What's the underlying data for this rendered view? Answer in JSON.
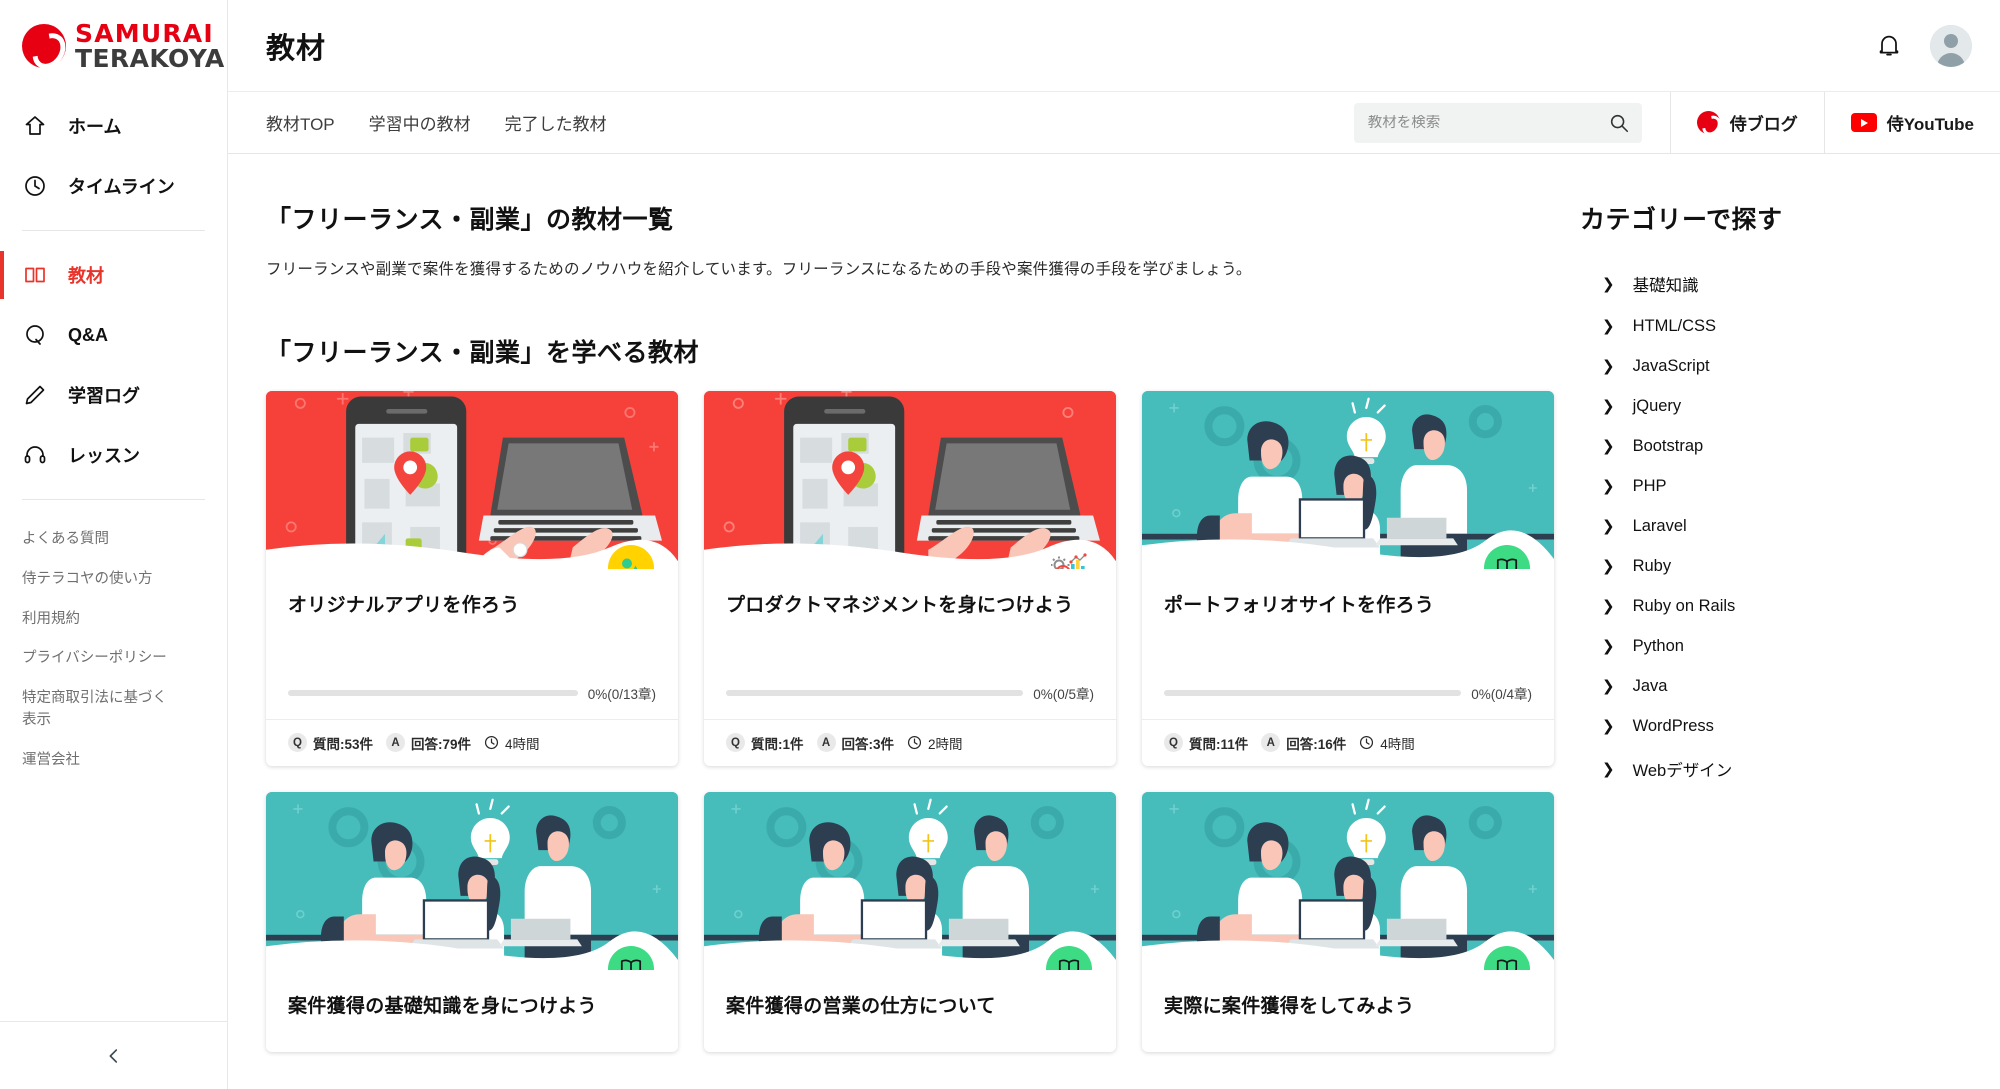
{
  "brand": {
    "line1": "SAMURAI",
    "line2": "TERAKOYA",
    "logo_color": "#e60012"
  },
  "sidebar": {
    "nav": [
      {
        "label": "ホーム",
        "icon": "home-icon",
        "active": false
      },
      {
        "label": "タイムライン",
        "icon": "clock-icon",
        "active": false
      },
      {
        "label": "教材",
        "icon": "book-icon",
        "active": true
      },
      {
        "label": "Q&A",
        "icon": "question-icon",
        "active": false
      },
      {
        "label": "学習ログ",
        "icon": "pencil-icon",
        "active": false
      },
      {
        "label": "レッスン",
        "icon": "headset-icon",
        "active": false
      }
    ],
    "links": [
      "よくある質問",
      "侍テラコヤの使い方",
      "利用規約",
      "プライバシーポリシー",
      "特定商取引法に基づく表示",
      "運営会社"
    ],
    "collapse_icon": "chevron-left-icon"
  },
  "header": {
    "title": "教材",
    "bell_icon": "bell-icon",
    "avatar_icon": "user-avatar-icon"
  },
  "tabs": [
    {
      "label": "教材TOP"
    },
    {
      "label": "学習中の教材"
    },
    {
      "label": "完了した教材"
    }
  ],
  "search": {
    "placeholder": "教材を検索",
    "value": "",
    "icon": "search-icon"
  },
  "external": [
    {
      "label": "侍ブログ",
      "icon": "samurai-logo-icon"
    },
    {
      "label": "侍YouTube",
      "icon": "youtube-icon"
    }
  ],
  "main": {
    "page_title": "「フリーランス・副業」の教材一覧",
    "page_desc": "フリーランスや副業で案件を獲得するためのノウハウを紹介しています。フリーランスになるための手段や案件獲得の手段を学びましょう。",
    "section_title": "「フリーランス・副業」を学べる教材"
  },
  "cards": [
    {
      "title": "オリジナルアプリを作ろう",
      "thumb": "red",
      "thumb_art": "phone-laptop",
      "badge_style": "yellow",
      "badge_icon": "shapes-icon",
      "progress_percent": 0,
      "progress_label": "0%(0/13章)",
      "q_label": "質問:53件",
      "a_label": "回答:79件",
      "time_label": "4時間"
    },
    {
      "title": "プロダクトマネジメントを身につけよう",
      "thumb": "red",
      "thumb_art": "phone-laptop",
      "badge_style": "white",
      "badge_icon": "analytics-icon",
      "progress_percent": 0,
      "progress_label": "0%(0/5章)",
      "q_label": "質問:1件",
      "a_label": "回答:3件",
      "time_label": "2時間"
    },
    {
      "title": "ポートフォリオサイトを作ろう",
      "thumb": "teal",
      "thumb_art": "team-work",
      "badge_style": "green",
      "badge_icon": "open-book-icon",
      "progress_percent": 0,
      "progress_label": "0%(0/4章)",
      "q_label": "質問:11件",
      "a_label": "回答:16件",
      "time_label": "4時間"
    },
    {
      "title": "案件獲得の基礎知識を身につけよう",
      "thumb": "teal",
      "thumb_art": "team-work",
      "badge_style": "green",
      "badge_icon": "open-book-icon",
      "progress_percent": 0,
      "progress_label": "",
      "q_label": "",
      "a_label": "",
      "time_label": ""
    },
    {
      "title": "案件獲得の営業の仕方について",
      "thumb": "teal",
      "thumb_art": "team-work",
      "badge_style": "green",
      "badge_icon": "open-book-icon",
      "progress_percent": 0,
      "progress_label": "",
      "q_label": "",
      "a_label": "",
      "time_label": ""
    },
    {
      "title": "実際に案件獲得をしてみよう",
      "thumb": "teal",
      "thumb_art": "team-work",
      "badge_style": "green",
      "badge_icon": "open-book-icon",
      "progress_percent": 0,
      "progress_label": "",
      "q_label": "",
      "a_label": "",
      "time_label": ""
    }
  ],
  "categories": {
    "title": "カテゴリーで探す",
    "items": [
      "基礎知識",
      "HTML/CSS",
      "JavaScript",
      "jQuery",
      "Bootstrap",
      "PHP",
      "Laravel",
      "Ruby",
      "Ruby on Rails",
      "Python",
      "Java",
      "WordPress",
      "Webデザイン"
    ]
  },
  "colors": {
    "accent_red": "#e8342a",
    "thumb_red": "#f5413a",
    "thumb_teal": "#46bdbb",
    "badge_yellow": "#ffd200",
    "badge_green": "#3ddc84"
  }
}
